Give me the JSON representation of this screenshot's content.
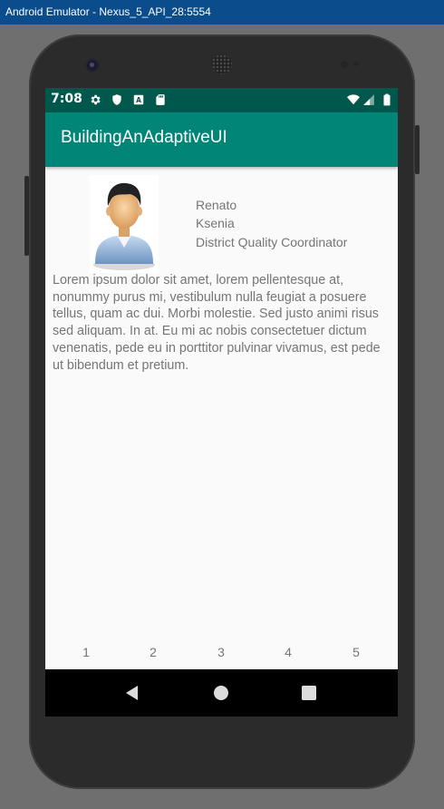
{
  "window": {
    "title": "Android Emulator - Nexus_5_API_28:5554"
  },
  "status_bar": {
    "time": "7:08",
    "left_icons": [
      "gear-icon",
      "shield-icon",
      "a-notification-icon",
      "sd-card-icon"
    ],
    "right_icons": [
      "wifi-icon",
      "signal-icon",
      "battery-icon"
    ]
  },
  "app_bar": {
    "title": "BuildingAnAdaptiveUI"
  },
  "profile": {
    "first_name": "Renato",
    "last_name": "Ksenia",
    "job_title": "District Quality Coordinator",
    "avatar_icon": "person-avatar-icon"
  },
  "description": "Lorem ipsum dolor sit amet, lorem pellentesque at, nonummy purus mi, vestibulum nulla feugiat a posuere tellus, quam ac dui. Morbi molestie. Sed justo animi risus sed aliquam. In at. Eu mi ac nobis consectetuer dictum venenatis, pede eu in porttitor pulvinar vivamus, est pede ut bibendum et pretium.",
  "page_tabs": [
    "1",
    "2",
    "3",
    "4",
    "5"
  ],
  "nav_bar": {
    "buttons": [
      "back-icon",
      "home-icon",
      "recents-icon"
    ]
  },
  "colors": {
    "status_bar": "#00574b",
    "app_bar": "#008577",
    "background": "#fafafa",
    "text_secondary": "#757575"
  }
}
